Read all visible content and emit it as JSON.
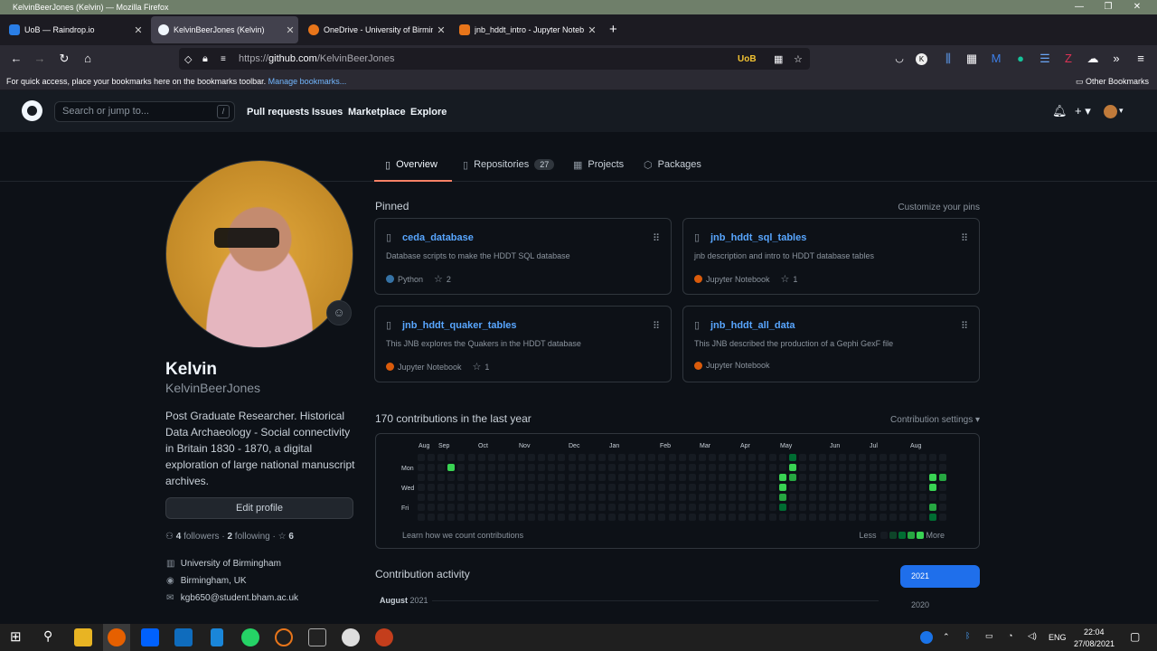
{
  "window": {
    "title": "KelvinBeerJones (Kelvin) — Mozilla Firefox"
  },
  "tabs": [
    {
      "label": "UoB — Raindrop.io",
      "color": "#2a7ee6"
    },
    {
      "label": "KelvinBeerJones (Kelvin)",
      "color": "#f0f6fc"
    },
    {
      "label": "OneDrive - University of Birmingham",
      "color": "#e8751a"
    },
    {
      "label": "jnb_hddt_intro - Jupyter Notebook",
      "color": "#e8751a"
    }
  ],
  "url": {
    "scheme": "https://",
    "host": "github.com",
    "path": "/KelvinBeerJones"
  },
  "urlbar_ext": "UoB",
  "bookmarks": {
    "message": "For quick access, place your bookmarks here on the bookmarks toolbar.",
    "link": "Manage bookmarks...",
    "other": "Other Bookmarks"
  },
  "github": {
    "search_placeholder": "Search or jump to...",
    "search_key": "/",
    "nav": [
      "Pull requests",
      "Issues",
      "Marketplace",
      "Explore"
    ]
  },
  "profile_tabs": {
    "overview": "Overview",
    "repositories": "Repositories",
    "repo_count": "27",
    "projects": "Projects",
    "packages": "Packages"
  },
  "profile": {
    "name": "Kelvin",
    "username": "KelvinBeerJones",
    "bio": "Post Graduate Researcher. Historical Data Archaeology - Social connectivity in Britain 1830 - 1870, a digital exploration of large national manuscript archives.",
    "edit_label": "Edit profile",
    "followers": "4",
    "followers_label": "followers",
    "following": "2",
    "following_label": "following",
    "stars": "6",
    "org": "University of Birmingham",
    "location": "Birmingham, UK",
    "email": "kgb650@student.bham.ac.uk"
  },
  "pinned": {
    "heading": "Pinned",
    "customize": "Customize your pins",
    "repos": [
      {
        "name": "ceda_database",
        "desc": "Database scripts to make the HDDT SQL database",
        "lang": "Python",
        "lang_color": "#3572a5",
        "stars": "2"
      },
      {
        "name": "jnb_hddt_sql_tables",
        "desc": "jnb description and intro to HDDT database tables",
        "lang": "Jupyter Notebook",
        "lang_color": "#da5b0b",
        "stars": "1"
      },
      {
        "name": "jnb_hddt_quaker_tables",
        "desc": "This JNB explores the Quakers in the HDDT database",
        "lang": "Jupyter Notebook",
        "lang_color": "#da5b0b",
        "stars": "1"
      },
      {
        "name": "jnb_hddt_all_data",
        "desc": "This JNB described the production of a Gephi GexF file",
        "lang": "Jupyter Notebook",
        "lang_color": "#da5b0b",
        "stars": ""
      }
    ]
  },
  "contrib": {
    "heading": "170 contributions in the last year",
    "settings": "Contribution settings ▾",
    "months": [
      "Aug",
      "Sep",
      "Oct",
      "Nov",
      "Dec",
      "Jan",
      "Feb",
      "Mar",
      "Apr",
      "May",
      "Jun",
      "Jul",
      "Aug"
    ],
    "days": [
      "Mon",
      "Wed",
      "Fri"
    ],
    "learn": "Learn how we count contributions",
    "less": "Less",
    "more": "More"
  },
  "activity": {
    "heading": "Contribution activity",
    "month": "August",
    "year": "2021",
    "years": [
      "2021",
      "2020"
    ]
  },
  "taskbar": {
    "lang": "ENG",
    "time": "22:04",
    "date": "27/08/2021"
  }
}
